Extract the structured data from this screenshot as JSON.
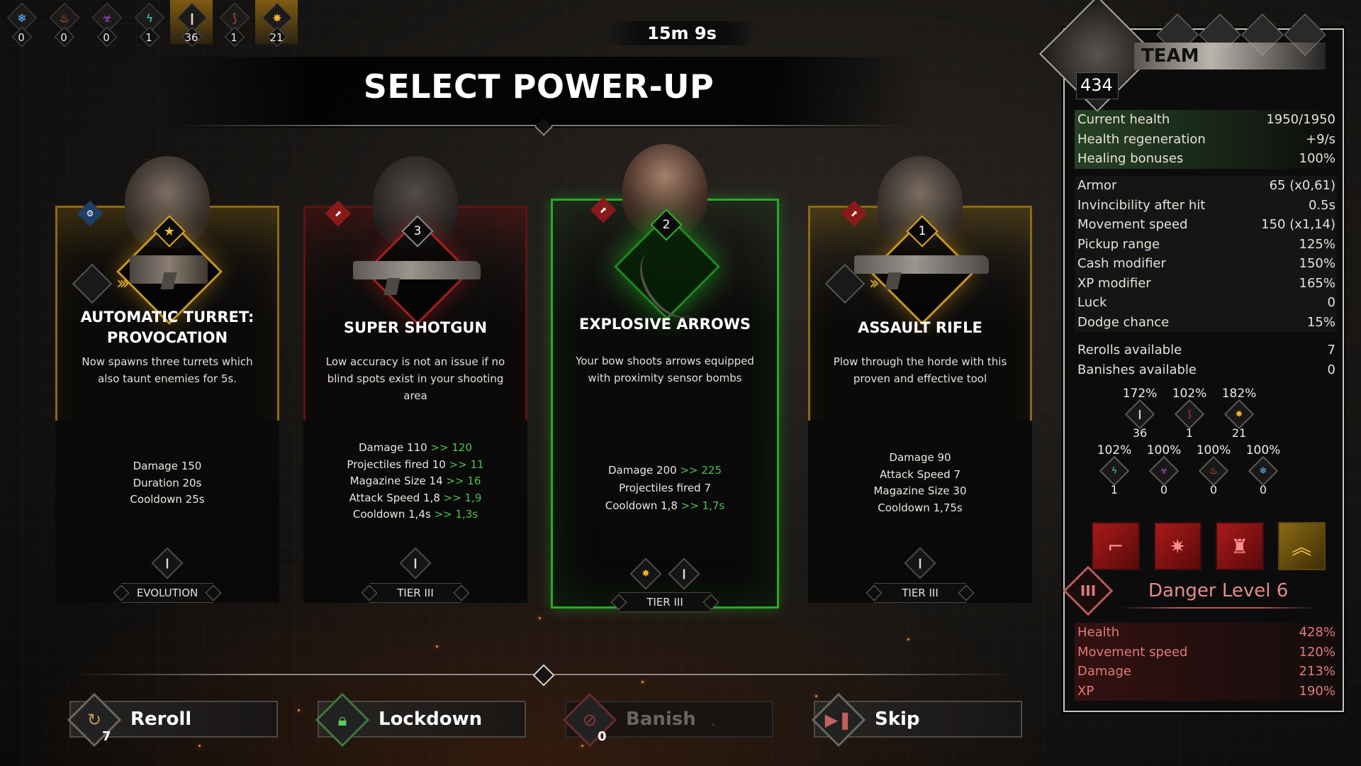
{
  "resources": [
    {
      "icon": "frost-icon",
      "glyph": "❄",
      "color": "#5fb7ff",
      "count": "0",
      "highlight": false
    },
    {
      "icon": "fire-icon",
      "glyph": "♨",
      "color": "#ff6a2a",
      "count": "0",
      "highlight": false
    },
    {
      "icon": "toxic-icon",
      "glyph": "☣",
      "color": "#a24bd4",
      "count": "0",
      "highlight": false
    },
    {
      "icon": "lightning-icon",
      "glyph": "ϟ",
      "color": "#3fd0d0",
      "count": "1",
      "highlight": false
    },
    {
      "icon": "bullet-icon",
      "glyph": "❙",
      "color": "#d8d3cc",
      "count": "36",
      "highlight": true
    },
    {
      "icon": "blood-icon",
      "glyph": "⟆",
      "color": "#d04a4a",
      "count": "1",
      "highlight": false
    },
    {
      "icon": "explosion-icon",
      "glyph": "✸",
      "color": "#f0b030",
      "count": "21",
      "highlight": true
    }
  ],
  "timer": "15m 9s",
  "title": "SELECT POWER-UP",
  "cards": [
    {
      "name_line1": "AUTOMATIC TURRET:",
      "name_line2": "PROVOCATION",
      "badge": "★",
      "description": "Now spawns three turrets which also taunt enemies for 5s.",
      "stats": [
        {
          "label": "Damage 150",
          "upgrade": ""
        },
        {
          "label": "Duration 20s",
          "upgrade": ""
        },
        {
          "label": "Cooldown 25s",
          "upgrade": ""
        }
      ],
      "tier": "EVOLUTION"
    },
    {
      "name": "SUPER SHOTGUN",
      "badge": "3",
      "description": "Low accuracy is not an issue if no blind spots exist in your shooting area",
      "stats": [
        {
          "label": "Damage 110",
          "upgrade": ">> 120"
        },
        {
          "label": "Projectiles fired 10",
          "upgrade": ">> 11"
        },
        {
          "label": "Magazine Size 14",
          "upgrade": ">> 16"
        },
        {
          "label": "Attack Speed 1,8",
          "upgrade": ">> 1,9"
        },
        {
          "label": "Cooldown 1,4s",
          "upgrade": ">> 1,3s"
        }
      ],
      "tier": "TIER III"
    },
    {
      "name": "EXPLOSIVE ARROWS",
      "badge": "2",
      "description": "Your bow shoots arrows equipped with proximity sensor bombs",
      "stats": [
        {
          "label": "Damage 200",
          "upgrade": ">> 225"
        },
        {
          "label": "Projectiles fired 7",
          "upgrade": ""
        },
        {
          "label": "Cooldown 1,8",
          "upgrade": ">> 1,7s"
        }
      ],
      "tier": "TIER III"
    },
    {
      "name": "ASSAULT RIFLE",
      "badge": "1",
      "description": "Plow through the horde with this proven and effective tool",
      "stats": [
        {
          "label": "Damage 90",
          "upgrade": ""
        },
        {
          "label": "Attack Speed 7",
          "upgrade": ""
        },
        {
          "label": "Magazine Size 30",
          "upgrade": ""
        },
        {
          "label": "Cooldown 1,75s",
          "upgrade": ""
        }
      ],
      "tier": "TIER III"
    }
  ],
  "actions": {
    "reroll": {
      "label": "Reroll",
      "count": "7"
    },
    "lockdown": {
      "label": "Lockdown"
    },
    "banish": {
      "label": "Banish",
      "count": "0"
    },
    "skip": {
      "label": "Skip"
    }
  },
  "team": {
    "label": "TEAM",
    "level": "434",
    "health_stats": [
      {
        "label": "Current health",
        "value": "1950/1950"
      },
      {
        "label": "Health regeneration",
        "value": "+9/s"
      },
      {
        "label": "Healing bonuses",
        "value": "100%"
      }
    ],
    "stats": [
      {
        "label": "Armor",
        "value": "65 (x0,61)"
      },
      {
        "label": "Invincibility after hit",
        "value": "0.5s"
      },
      {
        "label": "Movement speed",
        "value": "150 (x1,14)"
      },
      {
        "label": "Pickup range",
        "value": "125%"
      },
      {
        "label": "Cash modifier",
        "value": "150%"
      },
      {
        "label": "XP modifier",
        "value": "165%"
      },
      {
        "label": "Luck",
        "value": "0"
      },
      {
        "label": "Dodge chance",
        "value": "15%"
      }
    ],
    "rerolls": [
      {
        "label": "Rerolls available",
        "value": "7"
      },
      {
        "label": "Banishes available",
        "value": "0"
      }
    ],
    "multipliers": [
      {
        "pct": "172%",
        "icon": "bullet-icon",
        "glyph": "❙",
        "color": "#d8d3cc",
        "count": "36"
      },
      {
        "pct": "102%",
        "icon": "blood-icon",
        "glyph": "⟆",
        "color": "#d04a4a",
        "count": "1"
      },
      {
        "pct": "182%",
        "icon": "explosion-icon",
        "glyph": "✸",
        "color": "#f0b030",
        "count": "21"
      },
      {
        "pct": "102%",
        "icon": "lightning-icon",
        "glyph": "ϟ",
        "color": "#3fd0d0",
        "count": "1"
      },
      {
        "pct": "100%",
        "icon": "toxic-icon",
        "glyph": "☣",
        "color": "#a24bd4",
        "count": "0"
      },
      {
        "pct": "100%",
        "icon": "fire-icon",
        "glyph": "♨",
        "color": "#ff6a2a",
        "count": "0"
      },
      {
        "pct": "100%",
        "icon": "frost-icon",
        "glyph": "❄",
        "color": "#5fb7ff",
        "count": "0"
      }
    ],
    "perks": [
      {
        "icon": "pistol-icon"
      },
      {
        "icon": "burst-icon"
      },
      {
        "icon": "survivor-icon"
      },
      {
        "icon": "rank-chevron-icon"
      }
    ],
    "danger": {
      "level_badge": "III",
      "title": "Danger Level 6",
      "stats": [
        {
          "label": "Health",
          "value": "428%"
        },
        {
          "label": "Movement speed",
          "value": "120%"
        },
        {
          "label": "Damage",
          "value": "213%"
        },
        {
          "label": "XP",
          "value": "190%"
        }
      ]
    }
  }
}
